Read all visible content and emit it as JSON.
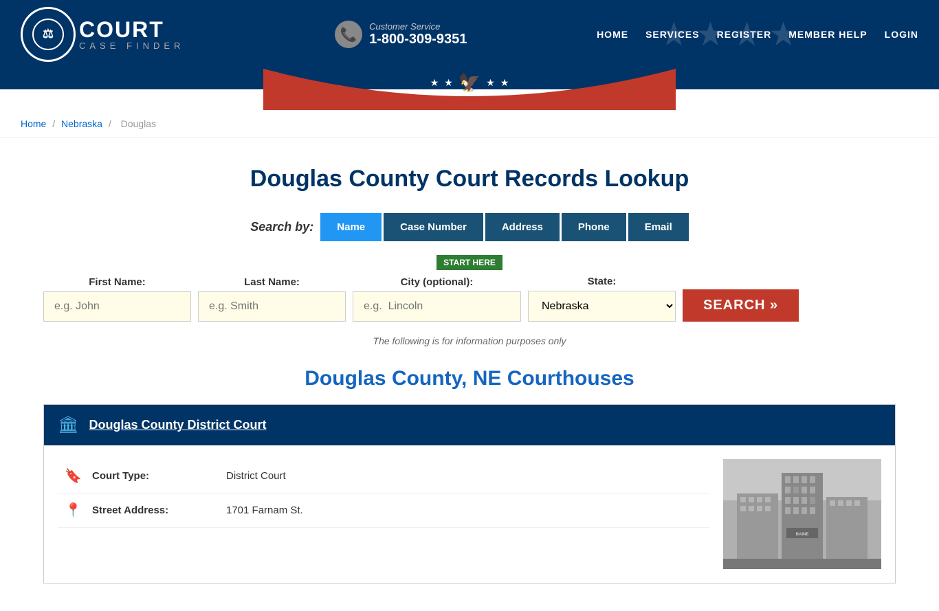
{
  "header": {
    "logo_court": "COURT",
    "logo_case_finder": "CASE FINDER",
    "customer_service_label": "Customer Service",
    "customer_service_phone": "1-800-309-9351",
    "nav": {
      "home": "HOME",
      "services": "SERVICES",
      "register": "REGISTER",
      "member_help": "MEMBER HELP",
      "login": "LOGIN"
    }
  },
  "breadcrumb": {
    "home": "Home",
    "state": "Nebraska",
    "county": "Douglas"
  },
  "main": {
    "page_title": "Douglas County Court Records Lookup",
    "search_by_label": "Search by:",
    "tabs": [
      {
        "label": "Name",
        "active": true
      },
      {
        "label": "Case Number",
        "active": false
      },
      {
        "label": "Address",
        "active": false
      },
      {
        "label": "Phone",
        "active": false
      },
      {
        "label": "Email",
        "active": false
      }
    ],
    "start_here": "START HERE",
    "form": {
      "first_name_label": "First Name:",
      "first_name_placeholder": "e.g. John",
      "last_name_label": "Last Name:",
      "last_name_placeholder": "e.g. Smith",
      "city_label": "City (optional):",
      "city_placeholder": "e.g.  Lincoln",
      "state_label": "State:",
      "state_value": "Nebraska",
      "search_button": "SEARCH »"
    },
    "info_note": "The following is for information purposes only",
    "courthouses_title": "Douglas County, NE Courthouses",
    "courts": [
      {
        "name": "Douglas County District Court",
        "court_type_label": "Court Type:",
        "court_type_value": "District Court",
        "address_label": "Street Address:",
        "address_value": "1701 Farnam St."
      }
    ]
  }
}
